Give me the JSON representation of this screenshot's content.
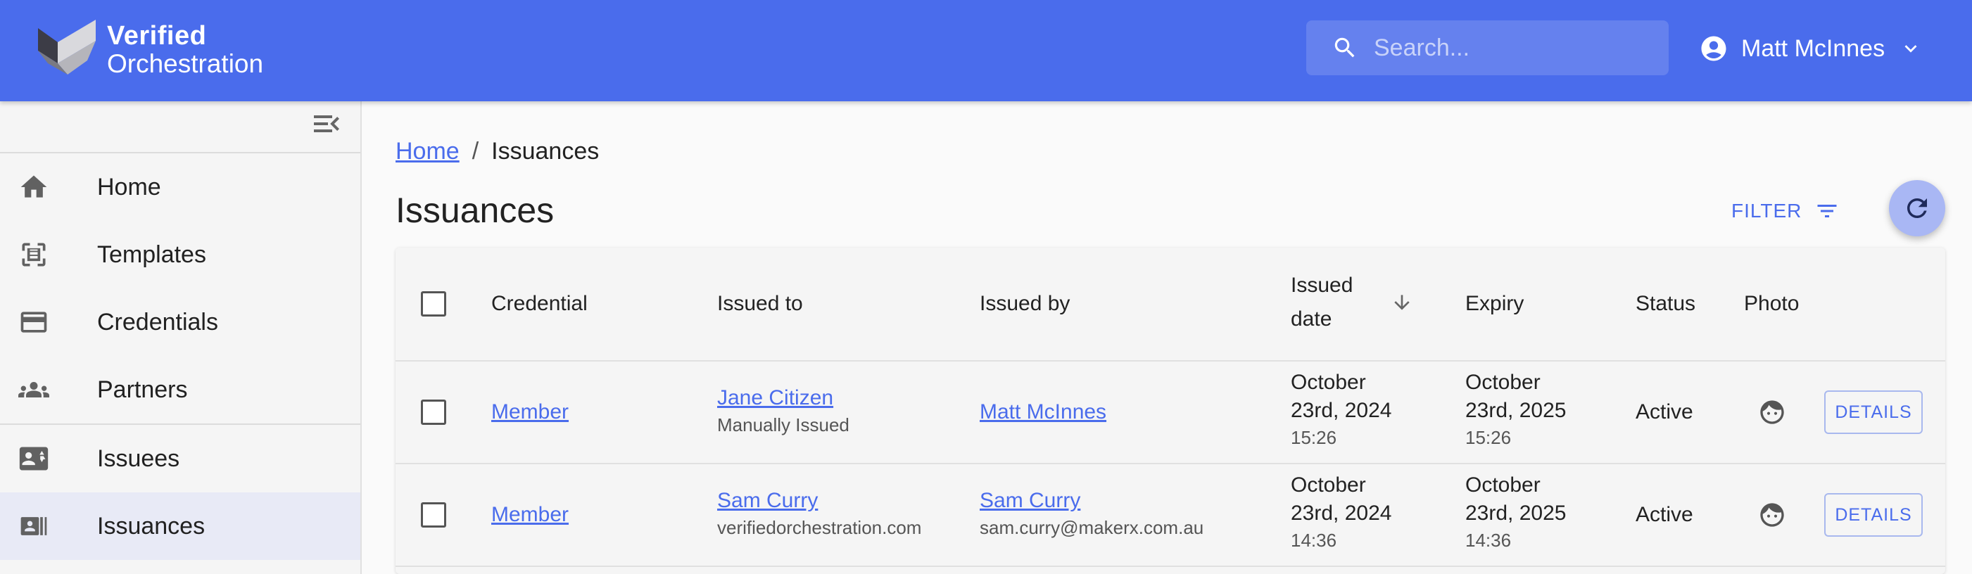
{
  "header": {
    "brand_line1": "Verified",
    "brand_line2": "Orchestration",
    "search_placeholder": "Search...",
    "user_name": "Matt McInnes",
    "bg_color": "#4a6cec"
  },
  "sidebar": {
    "items": [
      {
        "label": "Home",
        "icon": "home-icon"
      },
      {
        "label": "Templates",
        "icon": "templates-icon"
      },
      {
        "label": "Credentials",
        "icon": "credit-card-icon"
      },
      {
        "label": "Partners",
        "icon": "group-icon"
      },
      {
        "label": "Issuees",
        "icon": "contact-card-icon"
      },
      {
        "label": "Issuances",
        "icon": "issuances-icon",
        "active": true
      }
    ]
  },
  "breadcrumb": {
    "home": "Home",
    "separator": "/",
    "current": "Issuances"
  },
  "page": {
    "title": "Issuances",
    "filter_label": "FILTER"
  },
  "table": {
    "headers": {
      "credential": "Credential",
      "issued_to": "Issued to",
      "issued_by": "Issued by",
      "issued_date_1": "Issued",
      "issued_date_2": "date",
      "expiry": "Expiry",
      "status": "Status",
      "photo": "Photo"
    },
    "rows": [
      {
        "credential": "Member",
        "issued_to": "Jane Citizen",
        "issued_to_sub": "Manually Issued",
        "issued_by": "Matt McInnes",
        "issued_by_sub": "",
        "issued_line1": "October",
        "issued_line2": "23rd, 2024",
        "issued_time": "15:26",
        "expiry_line1": "October",
        "expiry_line2": "23rd, 2025",
        "expiry_time": "15:26",
        "status": "Active",
        "action": "DETAILS"
      },
      {
        "credential": "Member",
        "issued_to": "Sam Curry",
        "issued_to_sub": "verifiedorchestration.com",
        "issued_by": "Sam Curry",
        "issued_by_sub": "sam.curry@makerx.com.au",
        "issued_line1": "October",
        "issued_line2": "23rd, 2024",
        "issued_time": "14:36",
        "expiry_line1": "October",
        "expiry_line2": "23rd, 2025",
        "expiry_time": "14:36",
        "status": "Active",
        "action": "DETAILS"
      }
    ]
  }
}
